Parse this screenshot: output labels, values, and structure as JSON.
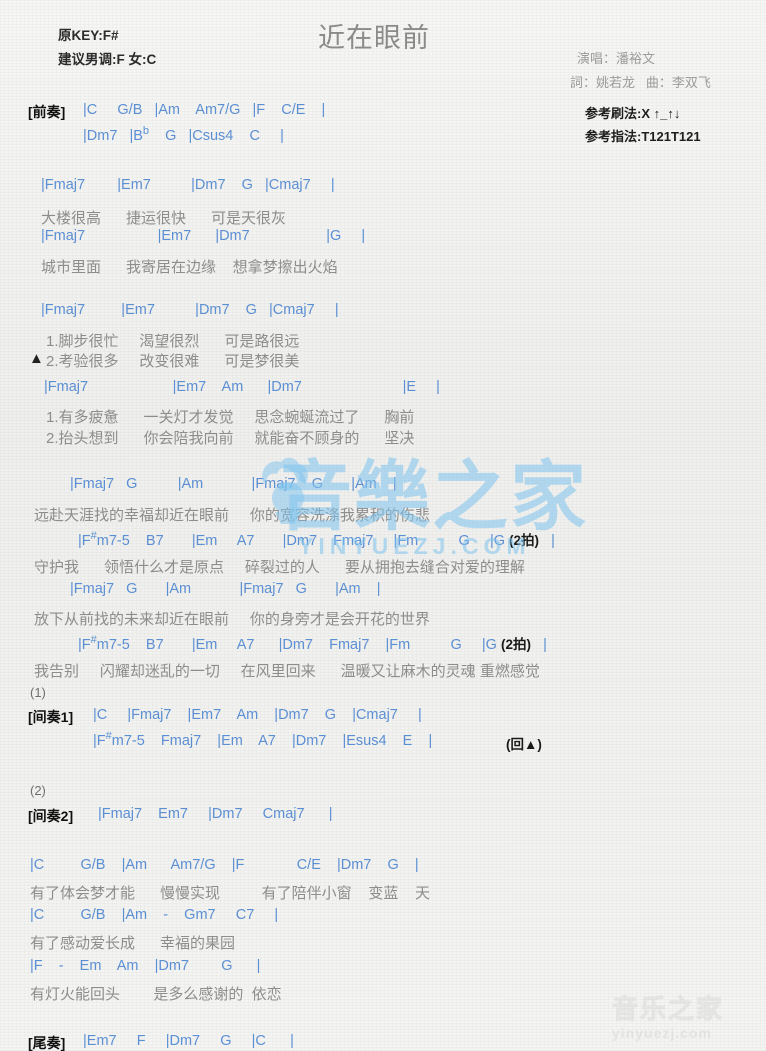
{
  "header": {
    "title": "近在眼前",
    "original_key": "原KEY:F#",
    "suggested_key": "建议男调:F 女:C",
    "singer": "演唱：潘裕文",
    "credits": "詞：姚若龙   曲：李双飞",
    "strum_ref": "参考刷法:X ↑_↑↓",
    "finger_ref": "参考指法:T121T121"
  },
  "watermarks": {
    "center_cn": "音樂之家",
    "center_en": "YINYUEZJ.COM",
    "bottom_cn": "音乐之家",
    "bottom_en": "yinyuezj.com"
  },
  "sections": {
    "intro_tag": "[前奏]",
    "interlude1_tag": "[间奏1]",
    "interlude2_tag": "[间奏2]",
    "outro_tag": "[尾奏]",
    "ending_mark_1": "(1)",
    "ending_mark_2": "(2)",
    "repeat_mark": "(回▲)"
  },
  "intro": {
    "line1": "|C     G/B   |Am    Am7/G   |F    C/E    |",
    "line2_a": "|Dm7   |B",
    "line2_flat": "b",
    "line2_b": "    G   |Csus4    C     |"
  },
  "verse1": {
    "chords_1": "|Fmaj7        |Em7          |Dm7    G   |Cmaj7     |",
    "lyrics_1": "大楼很高      捷运很快      可是天很灰",
    "chords_2": "|Fmaj7                  |Em7      |Dm7                   |G     |",
    "lyrics_2": "城市里面      我寄居在边缘    想拿梦擦出火焰"
  },
  "verse2": {
    "chords_1": "|Fmaj7         |Em7          |Dm7    G   |Cmaj7     |",
    "lyrics_1a": "1.脚步很忙     渴望很烈      可是路很远",
    "lyrics_1b_tri": "▲",
    "lyrics_1b": "2.考验很多     改变很难      可是梦很美",
    "chords_2": "|Fmaj7                     |Em7    Am      |Dm7                         |E     |",
    "lyrics_2a": "1.有多疲惫      一关灯才发觉     思念蜿蜒流过了      胸前",
    "lyrics_2b": "2.抬头想到      你会陪我向前     就能奋不顾身的      坚决"
  },
  "chorus1": {
    "chords_1": "|Fmaj7   G          |Am            |Fmaj7    G       |Am    |",
    "lyrics_1": "远赴天涯找的幸福却近在眼前     你的宽容洗涤我累积的伤悲",
    "chords_2_a": "|F",
    "chords_2_sharp": "#",
    "chords_2_b": "m7-5    B7       |Em     A7       |Dm7    Fmaj7     |Fm          G     |G ",
    "chords_2_annot": "(2拍)",
    "chords_2_end": "   |",
    "lyrics_2": "守护我      领悟什么才是原点     碎裂过的人      要从拥抱去缝合对爱的理解"
  },
  "chorus2": {
    "chords_1": "|Fmaj7   G       |Am            |Fmaj7   G       |Am    |",
    "lyrics_1": "放下从前找的未来却近在眼前     你的身旁才是会开花的世界",
    "chords_2_a": "|F",
    "chords_2_sharp": "#",
    "chords_2_b": "m7-5    B7       |Em     A7      |Dm7    Fmaj7    |Fm          G     |G ",
    "chords_2_annot": "(2拍)",
    "chords_2_end": "   |",
    "lyrics_2": "我告别     闪耀却迷乱的一切     在风里回来      温暖又让麻木的灵魂 重燃感觉"
  },
  "interlude1": {
    "line1": "|C     |Fmaj7    |Em7    Am    |Dm7    G    |Cmaj7     |",
    "line2_a": "|F",
    "line2_sharp": "#",
    "line2_b": "m7-5    Fmaj7    |Em    A7    |Dm7    |Esus4    E    |"
  },
  "interlude2": {
    "line1": "|Fmaj7    Em7     |Dm7     Cmaj7      |"
  },
  "verse3": {
    "chords_1": "|C         G/B    |Am      Am7/G    |F             C/E    |Dm7    G    |",
    "lyrics_1": "有了体会梦才能      慢慢实现          有了陪伴小窗    变蓝    天",
    "chords_2": "|C         G/B    |Am    -    Gm7     C7     |",
    "lyrics_2": "有了感动爱长成      幸福的果园",
    "chords_3": "|F    -    Em    Am    |Dm7        G      |",
    "lyrics_3": "有灯火能回头        是多么感谢的  依恋"
  },
  "outro": {
    "line1": "|Em7     F     |Dm7     G     |C      |"
  }
}
